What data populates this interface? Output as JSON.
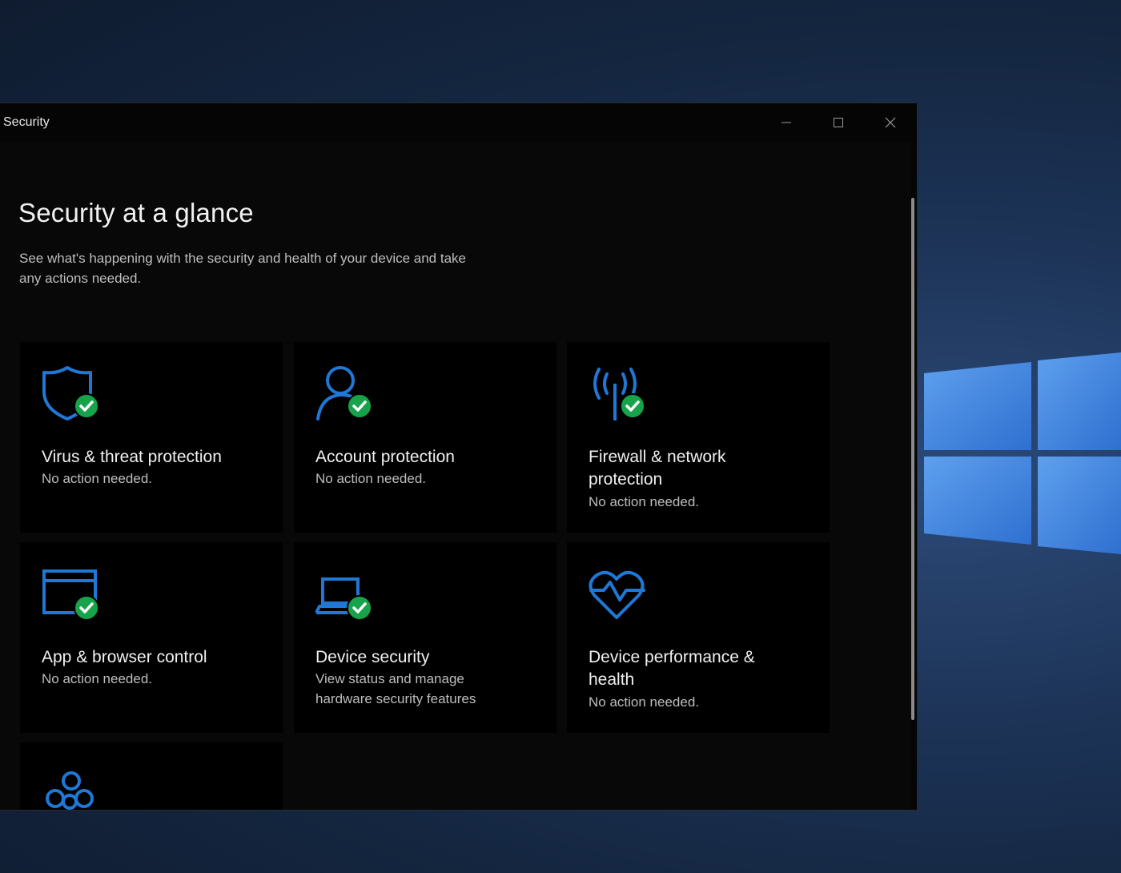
{
  "window": {
    "title": "Security",
    "controls": [
      "minimize",
      "maximize",
      "close"
    ]
  },
  "page": {
    "title": "Security at a glance",
    "description": "See what's happening with the security and health of your device and take any actions needed."
  },
  "tiles": [
    {
      "name": "Virus & threat protection",
      "status": "No action needed.",
      "icon": "shield-check-icon"
    },
    {
      "name": "Account protection",
      "status": "No action needed.",
      "icon": "person-check-icon"
    },
    {
      "name": "Firewall & network protection",
      "status": "No action needed.",
      "icon": "antenna-check-icon"
    },
    {
      "name": "App & browser control",
      "status": "No action needed.",
      "icon": "browser-window-check-icon"
    },
    {
      "name": "Device security",
      "status": "View status and manage hardware security features",
      "icon": "laptop-check-icon"
    },
    {
      "name": "Device performance & health",
      "status": "No action needed.",
      "icon": "heart-pulse-icon"
    },
    {
      "icon": "family-icon"
    }
  ],
  "colors": {
    "accent": "#1f78d6",
    "ok": "#16a34a",
    "tile_bg": "#000000"
  }
}
